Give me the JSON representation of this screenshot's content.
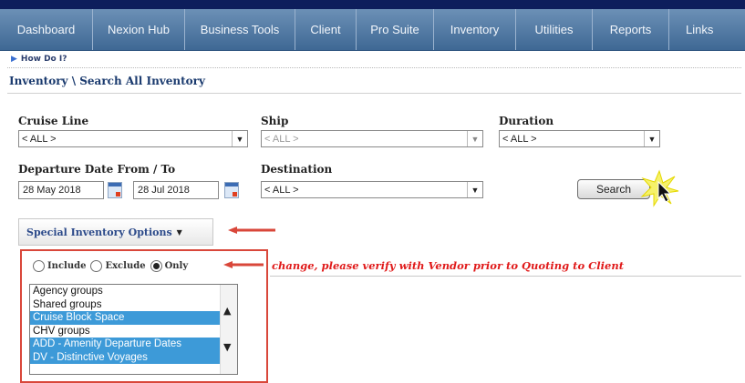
{
  "nav": {
    "items": [
      "Dashboard",
      "Nexion Hub",
      "Business Tools",
      "Client",
      "Pro Suite",
      "Inventory",
      "Utilities",
      "Reports",
      "Links"
    ]
  },
  "help": {
    "label": "How Do I?"
  },
  "breadcrumb": "Inventory \\ Search All Inventory",
  "form": {
    "cruise_line": {
      "label": "Cruise Line",
      "value": "< ALL >"
    },
    "ship": {
      "label": "Ship",
      "value": "< ALL >"
    },
    "duration": {
      "label": "Duration",
      "value": "< ALL >"
    },
    "departure": {
      "label": "Departure Date From / To",
      "from": "28 May 2018",
      "to": "28 Jul 2018"
    },
    "destination": {
      "label": "Destination",
      "value": "< ALL >"
    },
    "search_label": "Search"
  },
  "special": {
    "label": "Special Inventory Options",
    "radios": [
      {
        "label": "Include",
        "checked": false
      },
      {
        "label": "Exclude",
        "checked": false
      },
      {
        "label": "Only",
        "checked": true
      }
    ],
    "warning": "change, please verify with Vendor prior to Quoting to Client",
    "options": [
      {
        "label": "Agency groups",
        "selected": false
      },
      {
        "label": "Shared groups",
        "selected": false
      },
      {
        "label": "Cruise Block Space",
        "selected": true
      },
      {
        "label": "CHV groups",
        "selected": false
      },
      {
        "label": "ADD - Amenity Departure Dates",
        "selected": true
      },
      {
        "label": "DV - Distinctive Voyages",
        "selected": true
      }
    ]
  },
  "colors": {
    "nav_top": "#6c90b6",
    "nav_bottom": "#3f6894",
    "accent_red": "#d9473a",
    "selection_blue": "#3d9ad8",
    "warning_red": "#e01a1a"
  },
  "icons": [
    "calendar-icon",
    "dropdown-arrow-icon",
    "cursor-icon",
    "red-arrow-icon"
  ]
}
